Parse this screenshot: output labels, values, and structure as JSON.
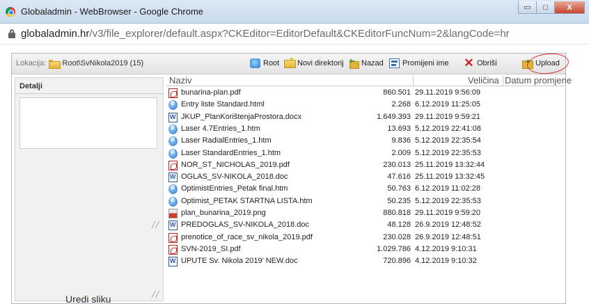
{
  "window": {
    "title": "Globaladmin - WebBrowser - Google Chrome",
    "min_glyph": "▭",
    "max_glyph": "□",
    "close_glyph": "X"
  },
  "address": {
    "host": "globaladmin.hr",
    "path": "/v3/file_explorer/default.aspx?CKEditor=EditorDefault&CKEditorFuncNum=2&langCode=hr"
  },
  "toolbar": {
    "location_label": "Lokacija:",
    "location_path": "Root\\SvNikola2019 (15)",
    "root_label": "Root",
    "new_dir_label": "Novi direktorij",
    "back_label": "Nazad",
    "rename_label": "Promijeni ime",
    "delete_label": "Obriši",
    "upload_label": "Upload"
  },
  "details": {
    "header": "Detalji",
    "edit_image_label": "Uredi sliku"
  },
  "columns": {
    "name": "Naziv",
    "size": "Veličina",
    "date": "Datum promjene"
  },
  "files": [
    {
      "icon": "pdf-icon",
      "name": "bunarina-plan.pdf",
      "size": "860.501",
      "date": "29.11.2019 9:56:09"
    },
    {
      "icon": "html-icon",
      "name": "Entry liste Standard.html",
      "size": "2.268",
      "date": "6.12.2019 11:25:05"
    },
    {
      "icon": "word-icon",
      "name": "JKUP_PlanKorištenjaProstora.docx",
      "size": "1.649.393",
      "date": "29.11.2019 9:59:21"
    },
    {
      "icon": "html-icon",
      "name": "Laser 4.7Entries_1.htm",
      "size": "13.693",
      "date": "5.12.2019 22:41:08"
    },
    {
      "icon": "html-icon",
      "name": "Laser RadialEntries_1.htm",
      "size": "9.836",
      "date": "5.12.2019 22:35:54"
    },
    {
      "icon": "html-icon",
      "name": "Laser StandardEntries_1.htm",
      "size": "2.009",
      "date": "5.12.2019 22:35:53"
    },
    {
      "icon": "pdf-icon",
      "name": "NOR_ST_NICHOLAS_2019.pdf",
      "size": "230.013",
      "date": "25.11.2019 13:32:44"
    },
    {
      "icon": "word-icon",
      "name": "OGLAS_SV-NIKOLA_2018.doc",
      "size": "47.616",
      "date": "25.11.2019 13:32:45"
    },
    {
      "icon": "html-icon",
      "name": "OptimistEntries_Petak final.htm",
      "size": "50.763",
      "date": "6.12.2019 11:02:28"
    },
    {
      "icon": "html-icon",
      "name": "Optimist_PETAK STARTNA LISTA.htm",
      "size": "50.235",
      "date": "5.12.2019 22:35:53"
    },
    {
      "icon": "image-icon",
      "name": "plan_bunarina_2019.png",
      "size": "880.818",
      "date": "29.11.2019 9:59:20"
    },
    {
      "icon": "word-icon",
      "name": "PREDOGLAS_SV-NIKOLA_2018.doc",
      "size": "48.128",
      "date": "26.9.2019 12:48:52"
    },
    {
      "icon": "pdf-icon",
      "name": "prenotice_of_race_sv_nikola_2019.pdf",
      "size": "230.028",
      "date": "26.9.2019 12:48:51"
    },
    {
      "icon": "pdf-icon",
      "name": "SVN-2019_SI.pdf",
      "size": "1.029.786",
      "date": "4.12.2019 9:10:31"
    },
    {
      "icon": "word-icon",
      "name": "UPUTE Sv. Nikola 2019' NEW.doc",
      "size": "720.896",
      "date": "4.12.2019 9:10:32"
    }
  ]
}
